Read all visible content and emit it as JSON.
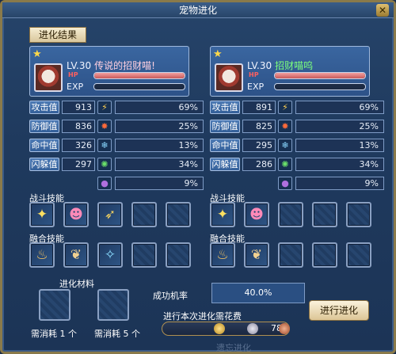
{
  "window": {
    "title": "宠物进化",
    "close_glyph": "✕"
  },
  "tab": {
    "label": "进化结果"
  },
  "left_pet": {
    "level": "LV.30",
    "name": "传说的招财喵!",
    "hp_label": "HP",
    "exp_label": "EXP",
    "hp_fraction": 1.0,
    "exp_fraction": 0.0,
    "stats": [
      {
        "label": "攻击值",
        "value": "913",
        "icon": "lightning-icon",
        "glyph": "⚡",
        "color": "#ffd050",
        "pct": "69%"
      },
      {
        "label": "防御值",
        "value": "836",
        "icon": "fire-icon",
        "glyph": "✸",
        "color": "#ff6a3a",
        "pct": "25%"
      },
      {
        "label": "命中值",
        "value": "326",
        "icon": "snowflake-icon",
        "glyph": "❄",
        "color": "#8ad8ff",
        "pct": "13%"
      },
      {
        "label": "闪躲值",
        "value": "297",
        "icon": "leaf-icon",
        "glyph": "✺",
        "color": "#6adf6a",
        "pct": "34%"
      },
      {
        "label": "",
        "value": "",
        "icon": "poison-icon",
        "glyph": "●",
        "color": "#b070e0",
        "pct": "9%"
      }
    ]
  },
  "right_pet": {
    "level": "LV.30",
    "name": "招财喵呜",
    "hp_label": "HP",
    "exp_label": "EXP",
    "hp_fraction": 1.0,
    "exp_fraction": 0.0,
    "stats": [
      {
        "label": "攻击值",
        "value": "891",
        "icon": "lightning-icon",
        "glyph": "⚡",
        "color": "#ffd050",
        "pct": "69%"
      },
      {
        "label": "防御值",
        "value": "825",
        "icon": "fire-icon",
        "glyph": "✸",
        "color": "#ff6a3a",
        "pct": "25%"
      },
      {
        "label": "命中值",
        "value": "295",
        "icon": "snowflake-icon",
        "glyph": "❄",
        "color": "#8ad8ff",
        "pct": "13%"
      },
      {
        "label": "闪躲值",
        "value": "286",
        "icon": "leaf-icon",
        "glyph": "✺",
        "color": "#6adf6a",
        "pct": "34%"
      },
      {
        "label": "",
        "value": "",
        "icon": "poison-icon",
        "glyph": "●",
        "color": "#b070e0",
        "pct": "9%"
      }
    ]
  },
  "skills": {
    "combat_label": "战斗技能",
    "fusion_label": "融合技能",
    "left_combat": [
      {
        "icon": "lightning-burst-icon",
        "glyph": "✦",
        "color": "#ffe060"
      },
      {
        "icon": "pink-spirit-icon",
        "glyph": "☻",
        "color": "#ff8ab8"
      },
      {
        "icon": "sword-strike-icon",
        "glyph": "➶",
        "color": "#f0d060"
      },
      {
        "icon": "empty-slot-icon"
      },
      {
        "icon": "empty-slot-icon"
      }
    ],
    "left_fusion": [
      {
        "icon": "golden-bell-icon",
        "glyph": "♨",
        "color": "#f0c060"
      },
      {
        "icon": "golden-feet-icon",
        "glyph": "❦",
        "color": "#f0d090"
      },
      {
        "icon": "blue-swirl-icon",
        "glyph": "✧",
        "color": "#8adcff"
      },
      {
        "icon": "empty-slot-icon"
      },
      {
        "icon": "empty-slot-icon"
      }
    ],
    "right_combat": [
      {
        "icon": "lightning-burst-icon",
        "glyph": "✦",
        "color": "#ffe060"
      },
      {
        "icon": "pink-spirit-icon",
        "glyph": "☻",
        "color": "#ff8ab8"
      },
      {
        "icon": "empty-slot-icon"
      },
      {
        "icon": "empty-slot-icon"
      },
      {
        "icon": "empty-slot-icon"
      }
    ],
    "right_fusion": [
      {
        "icon": "golden-bell-icon",
        "glyph": "♨",
        "color": "#f0c060"
      },
      {
        "icon": "golden-feet-icon",
        "glyph": "❦",
        "color": "#f0d090"
      },
      {
        "icon": "empty-slot-icon"
      },
      {
        "icon": "empty-slot-icon"
      },
      {
        "icon": "empty-slot-icon"
      }
    ]
  },
  "materials": {
    "label": "进化材料",
    "items": [
      {
        "caption": "需消耗  1 个"
      },
      {
        "caption": "需消耗  5 个"
      }
    ]
  },
  "success": {
    "label": "成功机率",
    "value": "40.0%"
  },
  "cost": {
    "label": "进行本次进化需花费",
    "value": "78"
  },
  "evolve_button": {
    "label": "进行进化"
  },
  "background_text": "遗忘进化"
}
